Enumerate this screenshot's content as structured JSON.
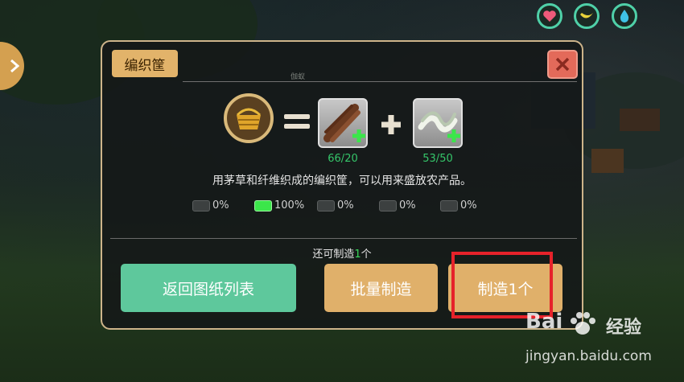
{
  "panel": {
    "title": "编织筐",
    "small_hint": "伽蚁",
    "product_icon": "woven-basket-icon",
    "materials": [
      {
        "icon": "thatch-grass-icon",
        "count": "66/20"
      },
      {
        "icon": "plant-fiber-icon",
        "count": "53/50"
      }
    ],
    "description": "用茅草和纤维织成的编织筐，可以用来盛放农产品。",
    "quality_levels": [
      {
        "label": "0%",
        "active": false
      },
      {
        "label": "100%",
        "active": true
      },
      {
        "label": "0%",
        "active": false
      },
      {
        "label": "0%",
        "active": false
      },
      {
        "label": "0%",
        "active": false
      }
    ],
    "remaining_prefix": "还可制造",
    "remaining_count": "1",
    "remaining_suffix": "个",
    "buttons": {
      "back": "返回图纸列表",
      "batch": "批量制造",
      "make_one": "制造1个"
    }
  },
  "hud": {
    "status_icons": [
      "heart-icon",
      "banana-icon",
      "water-drop-icon"
    ],
    "side_tab_icon": "chevron-right-icon"
  },
  "watermark": {
    "brand": "Bai",
    "brand_suffix": "经验",
    "url": "jingyan.baidu.com"
  },
  "colors": {
    "accent_green": "#5ec89c",
    "button_gold": "#e0b06a",
    "close_red": "#e36a5a",
    "highlight_red": "#e6222a",
    "count_green": "#35c66a"
  }
}
